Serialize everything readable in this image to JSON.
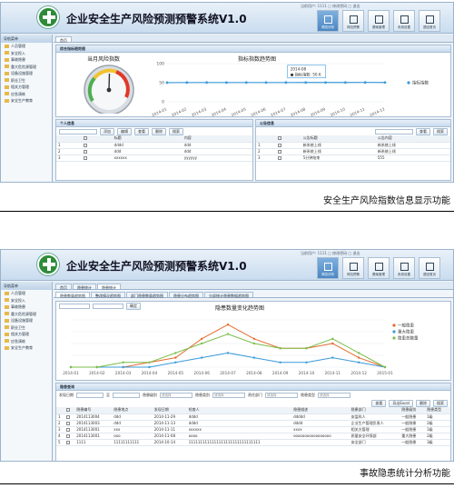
{
  "app": {
    "title": "企业安全生产风险预测预警系统V1.0",
    "user_bar": "当前用户: 1111  ▢ 修改密码  ▢ 退出"
  },
  "toolbar": [
    {
      "label": "风险分析"
    },
    {
      "label": "风险预警"
    },
    {
      "label": "基础管理"
    },
    {
      "label": "系统设置"
    },
    {
      "label": "退回首页"
    }
  ],
  "sidebar": {
    "title": "导航菜单",
    "items": [
      "人员管理",
      "安全投入",
      "事故隐患",
      "重大危险源管理",
      "设备设施管理",
      "职业卫生",
      "相关方管理",
      "应急演练",
      "安全生产教育"
    ]
  },
  "screen1": {
    "tabs": [
      "首页"
    ],
    "section_title": "综合指标趋势图",
    "gauge": {
      "title": "当月风险指数",
      "value": 50.6
    },
    "trend": {
      "title": "指标指数趋势图",
      "tooltip_date": "2014-08",
      "tooltip_value": "● 指标指数: 50.6",
      "legend": "指标指数"
    },
    "person_panel": {
      "title": "个人信息",
      "toolbar": [
        "添加",
        "编辑",
        "查看",
        "删除",
        "搜索"
      ],
      "columns": [
        "",
        "",
        "标题",
        "内容"
      ],
      "rows": [
        [
          "1",
          "",
          "dddd",
          "ddd"
        ],
        [
          "2",
          "",
          "ddd",
          "ddd"
        ],
        [
          "3",
          "",
          "xxxxxx",
          "yyyyyy"
        ]
      ]
    },
    "notice_panel": {
      "title": "公告信息",
      "toolbar": [
        "查看",
        "搜索"
      ],
      "columns": [
        "",
        "",
        "公告标题",
        "公告内容"
      ],
      "rows": [
        [
          "1",
          "",
          "新系统上线",
          "新系统上线"
        ],
        [
          "2",
          "",
          "新系统上线",
          "新系统上线"
        ],
        [
          "3",
          "",
          "5分钟结束",
          "555"
        ]
      ]
    },
    "caption": "安全生产风险指数信息显示功能"
  },
  "screen2": {
    "tabs": [
      "首页",
      "隐患统计",
      "隐患统计"
    ],
    "subtabs": [
      "隐患数量趋势图",
      "整改情况趋势图",
      "部门隐患数量趋势图",
      "隐患分布趋势图",
      "分部统计隐患数据趋势图"
    ],
    "filter": {
      "go_label": "确定"
    },
    "chart": {
      "title": "隐患数量变化趋势图",
      "legend": [
        "一般隐患",
        "重大隐患",
        "隐患总数量"
      ]
    },
    "query_panel": {
      "title": "隐患查询",
      "labels": [
        "发现日期",
        "至",
        "隐患级别",
        "隐患类别",
        "责任部门",
        "隐患类型"
      ],
      "select_placeholder": "请选择",
      "toolbar": [
        "查看",
        "导出Excel",
        "删除",
        "搜索"
      ]
    },
    "table": {
      "columns": [
        "",
        "",
        "隐患编号",
        "隐患地点",
        "发现日期",
        "检查人",
        "隐患描述",
        "隐患部门",
        "隐患级别",
        "隐患类型"
      ],
      "rows": [
        [
          "1",
          "",
          "2014113004",
          "ddd",
          "2014-11-29",
          "dddd",
          "ddddd",
          "安监科人",
          "一般隐患",
          "1级"
        ],
        [
          "2",
          "",
          "2014113003",
          "ddd",
          "2014-11-13",
          "dddd",
          "dddd",
          "企业生产管理负责人",
          "一般隐患",
          "2级"
        ],
        [
          "3",
          "",
          "2014113001",
          "xxx",
          "2014-11-11",
          "xxxxxx",
          "xxxx",
          "相关方管理",
          "一般隐患",
          "1级"
        ],
        [
          "4",
          "",
          "2014113001",
          "ooo",
          "2014-11-08",
          "oooo",
          "ooooooooooooooooo",
          "质量安全环保部",
          "重大隐患",
          "2级"
        ],
        [
          "5",
          "",
          "1111",
          "11111111111",
          "2014-10-14",
          "1111111111111111111111111111111",
          "",
          "安全部门",
          "一般隐患",
          "3级"
        ]
      ]
    },
    "caption": "事故隐患统计分析功能"
  },
  "chart_data": [
    {
      "type": "line",
      "title": "指标指数趋势图",
      "x": [
        "2014-01",
        "2014-02",
        "2014-03",
        "2014-04",
        "2014-05",
        "2014-06",
        "2014-07",
        "2014-08",
        "2014-09",
        "2014-10",
        "2014-11",
        "2014-12"
      ],
      "series": [
        {
          "name": "指标指数",
          "values": [
            50.2,
            50.4,
            50.5,
            50.4,
            50.5,
            50.5,
            50.5,
            50.6,
            50.6,
            50.6,
            50.7,
            50.6
          ]
        }
      ],
      "yticks": [
        100,
        50,
        0
      ],
      "ylim": [
        0,
        100
      ],
      "legend": "right"
    },
    {
      "type": "line",
      "title": "隐患数量变化趋势图",
      "x": [
        "2014-01",
        "2014-02",
        "2014-03",
        "2014-04",
        "2014-05",
        "2014-06",
        "2014-07",
        "2014-08",
        "2014-09",
        "2014-10",
        "2014-11",
        "2014-12",
        "2015-01"
      ],
      "series": [
        {
          "name": "一般隐患",
          "color": "#e46b2d",
          "values": [
            0,
            0,
            0,
            1,
            2,
            6,
            9,
            6,
            4,
            4,
            5,
            2,
            0
          ]
        },
        {
          "name": "重大隐患",
          "color": "#3a9ad8",
          "values": [
            0,
            0,
            0,
            0,
            1,
            2,
            3,
            2,
            1,
            1,
            2,
            1,
            0
          ]
        },
        {
          "name": "隐患总数量",
          "color": "#7bbf4a",
          "values": [
            0,
            0,
            1,
            1,
            3,
            5,
            7,
            5,
            4,
            4,
            6,
            3,
            0
          ]
        }
      ],
      "ylim": [
        0,
        10
      ],
      "legend": "right"
    }
  ]
}
